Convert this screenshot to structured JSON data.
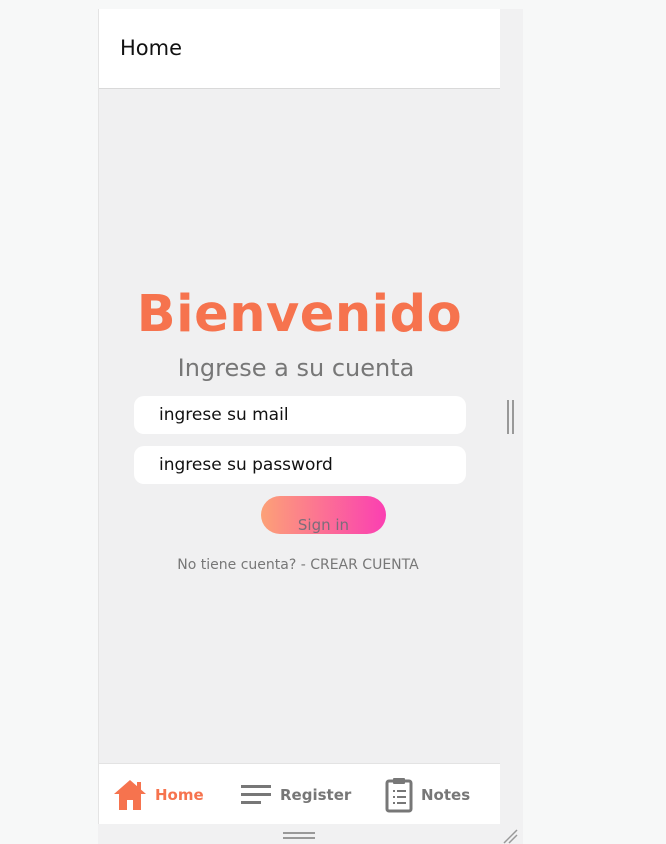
{
  "header": {
    "title": "Home"
  },
  "login": {
    "title": "Bienvenido",
    "subtitle": "Ingrese a su cuenta",
    "email_placeholder": "ingrese su mail",
    "password_placeholder": "ingrese su password",
    "signin_label": "Sign in",
    "no_account": "No tiene cuenta? - CREAR CUENTA"
  },
  "nav": {
    "items": [
      {
        "label": "Home",
        "icon": "home-icon",
        "active": true
      },
      {
        "label": "Register",
        "icon": "menu-lines-icon",
        "active": false
      },
      {
        "label": "Notes",
        "icon": "clipboard-icon",
        "active": false
      }
    ]
  },
  "colors": {
    "accent": "#f6734e",
    "gradient_start": "#fca177",
    "gradient_end": "#fb3fb2",
    "muted": "#777777"
  }
}
